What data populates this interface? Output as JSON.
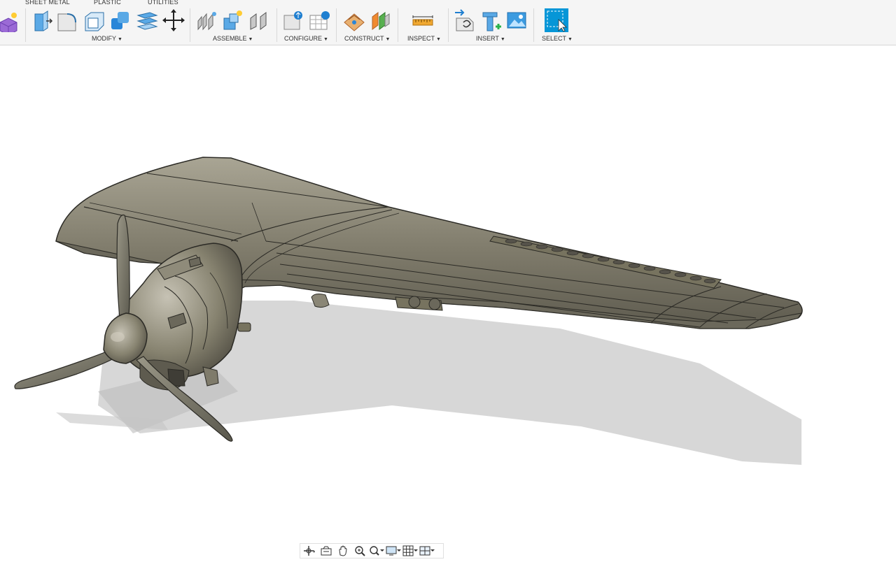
{
  "toolbar": {
    "tabs": [
      "SHEET METAL",
      "PLASTIC",
      "UTILITIES"
    ],
    "groups": {
      "modify": "MODIFY",
      "assemble": "ASSEMBLE",
      "configure": "CONFIGURE",
      "construct": "CONSTRUCT",
      "inspect": "INSPECT",
      "insert": "INSERT",
      "select": "SELECT"
    },
    "icons": {
      "create": [
        "create-form-icon"
      ],
      "modify": [
        "press-pull-icon",
        "fillet-icon",
        "shell-icon",
        "combine-icon",
        "offset-face-icon",
        "move-copy-icon"
      ],
      "assemble": [
        "joint-icon",
        "new-component-icon",
        "as-built-joint-icon"
      ],
      "configure": [
        "configure-table-icon",
        "configure-rules-icon"
      ],
      "construct": [
        "offset-plane-icon",
        "midplane-icon"
      ],
      "inspect": [
        "measure-icon"
      ],
      "insert": [
        "insert-derive-icon",
        "insert-mesh-icon",
        "insert-canvas-icon"
      ],
      "select": [
        "window-select-icon"
      ]
    }
  },
  "navbar": {
    "icons": [
      "orbit-icon",
      "look-at-icon",
      "pan-icon",
      "zoom-icon",
      "fit-icon",
      "display-settings-icon",
      "grid-icon",
      "viewports-icon"
    ]
  },
  "colors": {
    "accent": "#0696d7",
    "model": "#8a8676",
    "shadow": "#c9c9c9"
  }
}
